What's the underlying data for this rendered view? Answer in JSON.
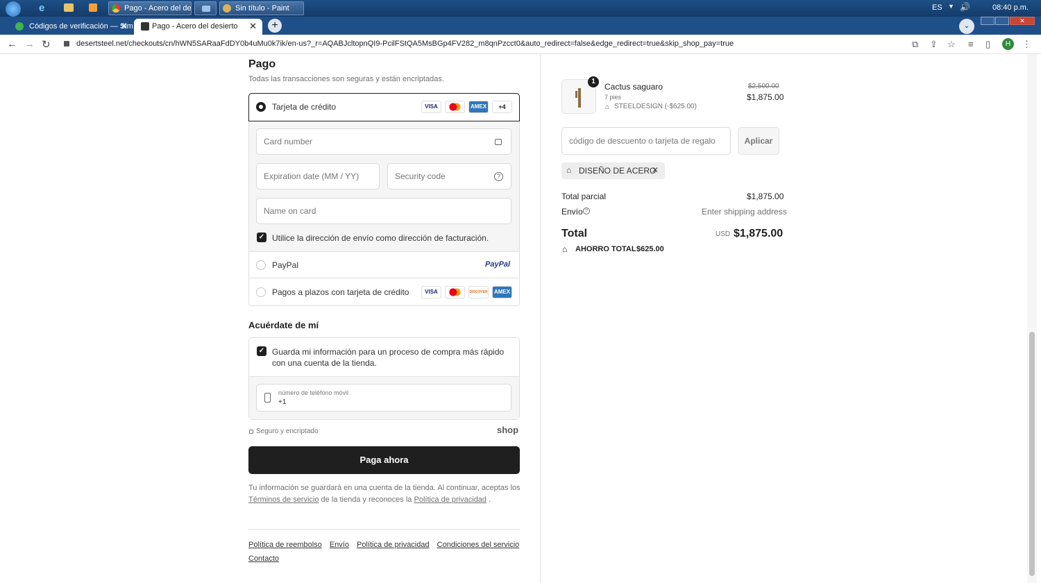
{
  "taskbar": {
    "tasks": [
      "Pago - Acero del des...",
      "",
      "Sin título - Paint"
    ],
    "lang": "ES",
    "time": "08:40 p.m."
  },
  "browser": {
    "tabs": [
      {
        "label": "Códigos de verificación — Simpl"
      },
      {
        "label": "Pago - Acero del desierto"
      }
    ],
    "url": "desertsteel.net/checkouts/cn/hWN5SARaaFdDY0b4uMu0k7ik/en-us?_r=AQABJcltopnQI9-PcilFStQA5MsBGp4FV282_m8qnPzcct0&auto_redirect=false&edge_redirect=true&skip_shop_pay=true",
    "profile": "H"
  },
  "payment": {
    "title": "Pago",
    "subtitle": "Todas las transacciones son seguras y están encriptadas.",
    "credit_label": "Tarjeta de crédito",
    "more_cards": "+4",
    "card_number_placeholder": "Card number",
    "expiry_placeholder": "Expiration date (MM / YY)",
    "security_placeholder": "Security code",
    "name_placeholder": "Name on card",
    "billing_same": "Utilice la dirección de envío como dirección de facturación.",
    "paypal_label": "PayPal",
    "paypal_logo": "PayPal",
    "installments_label": "Pagos a plazos con tarjeta de crédito",
    "cards": [
      "VISA",
      "",
      "AMEX"
    ],
    "cards2": [
      "VISA",
      "",
      "DISCOVER",
      "AMEX"
    ]
  },
  "remember": {
    "title": "Acuérdate de mí",
    "save_info": "Guarda mi información para un proceso de compra más rápido con una cuenta de la tienda.",
    "phone_label": "número de teléfono móvil",
    "phone_value": "+1",
    "secure": "Seguro y encriptado",
    "shop_logo": "shop"
  },
  "pay_button": "Paga ahora",
  "legal": {
    "text1": "Tu información se guardará en una cuenta de la tienda. Al continuar, aceptas los",
    "terms": "Términos de servicio",
    "text2": "de la tienda y reconoces la",
    "privacy": "Política de privacidad",
    "text3": "."
  },
  "footer": {
    "links": [
      "Política de reembolso",
      "Envío",
      "Política de privacidad",
      "Condiciones del servicio",
      "Contacto"
    ]
  },
  "summary": {
    "qty": "1",
    "product": "Cactus saguaro",
    "variant": "7 pies",
    "discount_code_line": "STEELDESIGN (-$625.00)",
    "old_price": "$2,500.00",
    "price": "$1,875.00",
    "discount_placeholder": "código de descuento o tarjeta de regalo",
    "apply": "Aplicar",
    "applied_tag": "DISEÑO DE ACERO",
    "subtotal_label": "Total parcial",
    "subtotal": "$1,875.00",
    "shipping_label": "Envío",
    "shipping_value": "Enter shipping address",
    "total_label": "Total",
    "currency": "USD",
    "total": "$1,875.00",
    "savings_label": "AHORRO TOTAL",
    "savings": "$625.00"
  }
}
